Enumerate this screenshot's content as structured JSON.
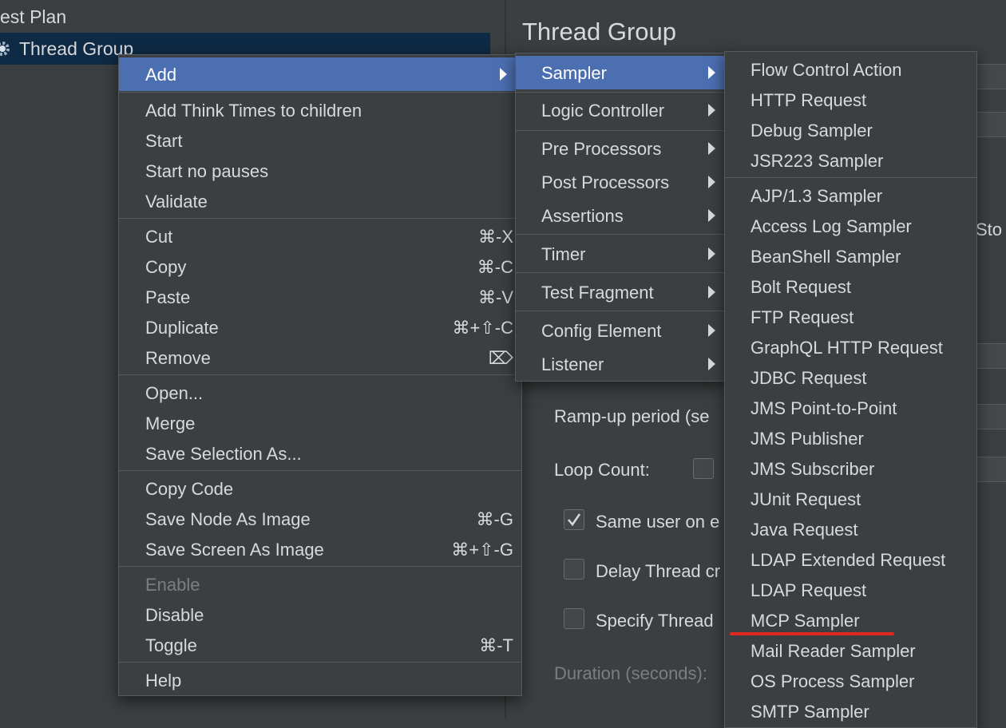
{
  "tree": {
    "test_plan": "est Plan",
    "thread_group": "Thread Group"
  },
  "panel": {
    "title": "Thread Group",
    "partial_stop": "Sto",
    "ramp_up_label": "Ramp-up period (se",
    "loop_count_label": "Loop Count:",
    "same_user_label": "Same user on e",
    "delay_thread_label": "Delay Thread cr",
    "specify_thread_label": "Specify Thread",
    "duration_label": "Duration (seconds):"
  },
  "context_menu": {
    "add": "Add",
    "add_think_times": "Add Think Times to children",
    "start": "Start",
    "start_no_pauses": "Start no pauses",
    "validate": "Validate",
    "cut": "Cut",
    "cut_key": "⌘-X",
    "copy": "Copy",
    "copy_key": "⌘-C",
    "paste": "Paste",
    "paste_key": "⌘-V",
    "duplicate": "Duplicate",
    "duplicate_key": "⌘+⇧-C",
    "remove": "Remove",
    "remove_key": "⌦",
    "open": "Open...",
    "merge": "Merge",
    "save_selection_as": "Save Selection As...",
    "copy_code": "Copy Code",
    "save_node_as_image": "Save Node As Image",
    "save_node_key": "⌘-G",
    "save_screen_as_image": "Save Screen As Image",
    "save_screen_key": "⌘+⇧-G",
    "enable": "Enable",
    "disable": "Disable",
    "toggle": "Toggle",
    "toggle_key": "⌘-T",
    "help": "Help"
  },
  "add_submenu": {
    "sampler": "Sampler",
    "logic_controller": "Logic Controller",
    "pre_processors": "Pre Processors",
    "post_processors": "Post Processors",
    "assertions": "Assertions",
    "timer": "Timer",
    "test_fragment": "Test Fragment",
    "config_element": "Config Element",
    "listener": "Listener"
  },
  "sampler_submenu": {
    "group1": [
      "Flow Control Action",
      "HTTP Request",
      "Debug Sampler",
      "JSR223 Sampler"
    ],
    "group2": [
      "AJP/1.3 Sampler",
      "Access Log Sampler",
      "BeanShell Sampler",
      "Bolt Request",
      "FTP Request",
      "GraphQL HTTP Request",
      "JDBC Request",
      "JMS Point-to-Point",
      "JMS Publisher",
      "JMS Subscriber",
      "JUnit Request",
      "Java Request",
      "LDAP Extended Request",
      "LDAP Request",
      "MCP Sampler",
      "Mail Reader Sampler",
      "OS Process Sampler",
      "SMTP Sampler"
    ]
  },
  "colors": {
    "background": "#3c3f41",
    "selection": "#4c6fb2",
    "tree_selection": "#0e2a44",
    "highlight_underline": "#e0281f"
  }
}
